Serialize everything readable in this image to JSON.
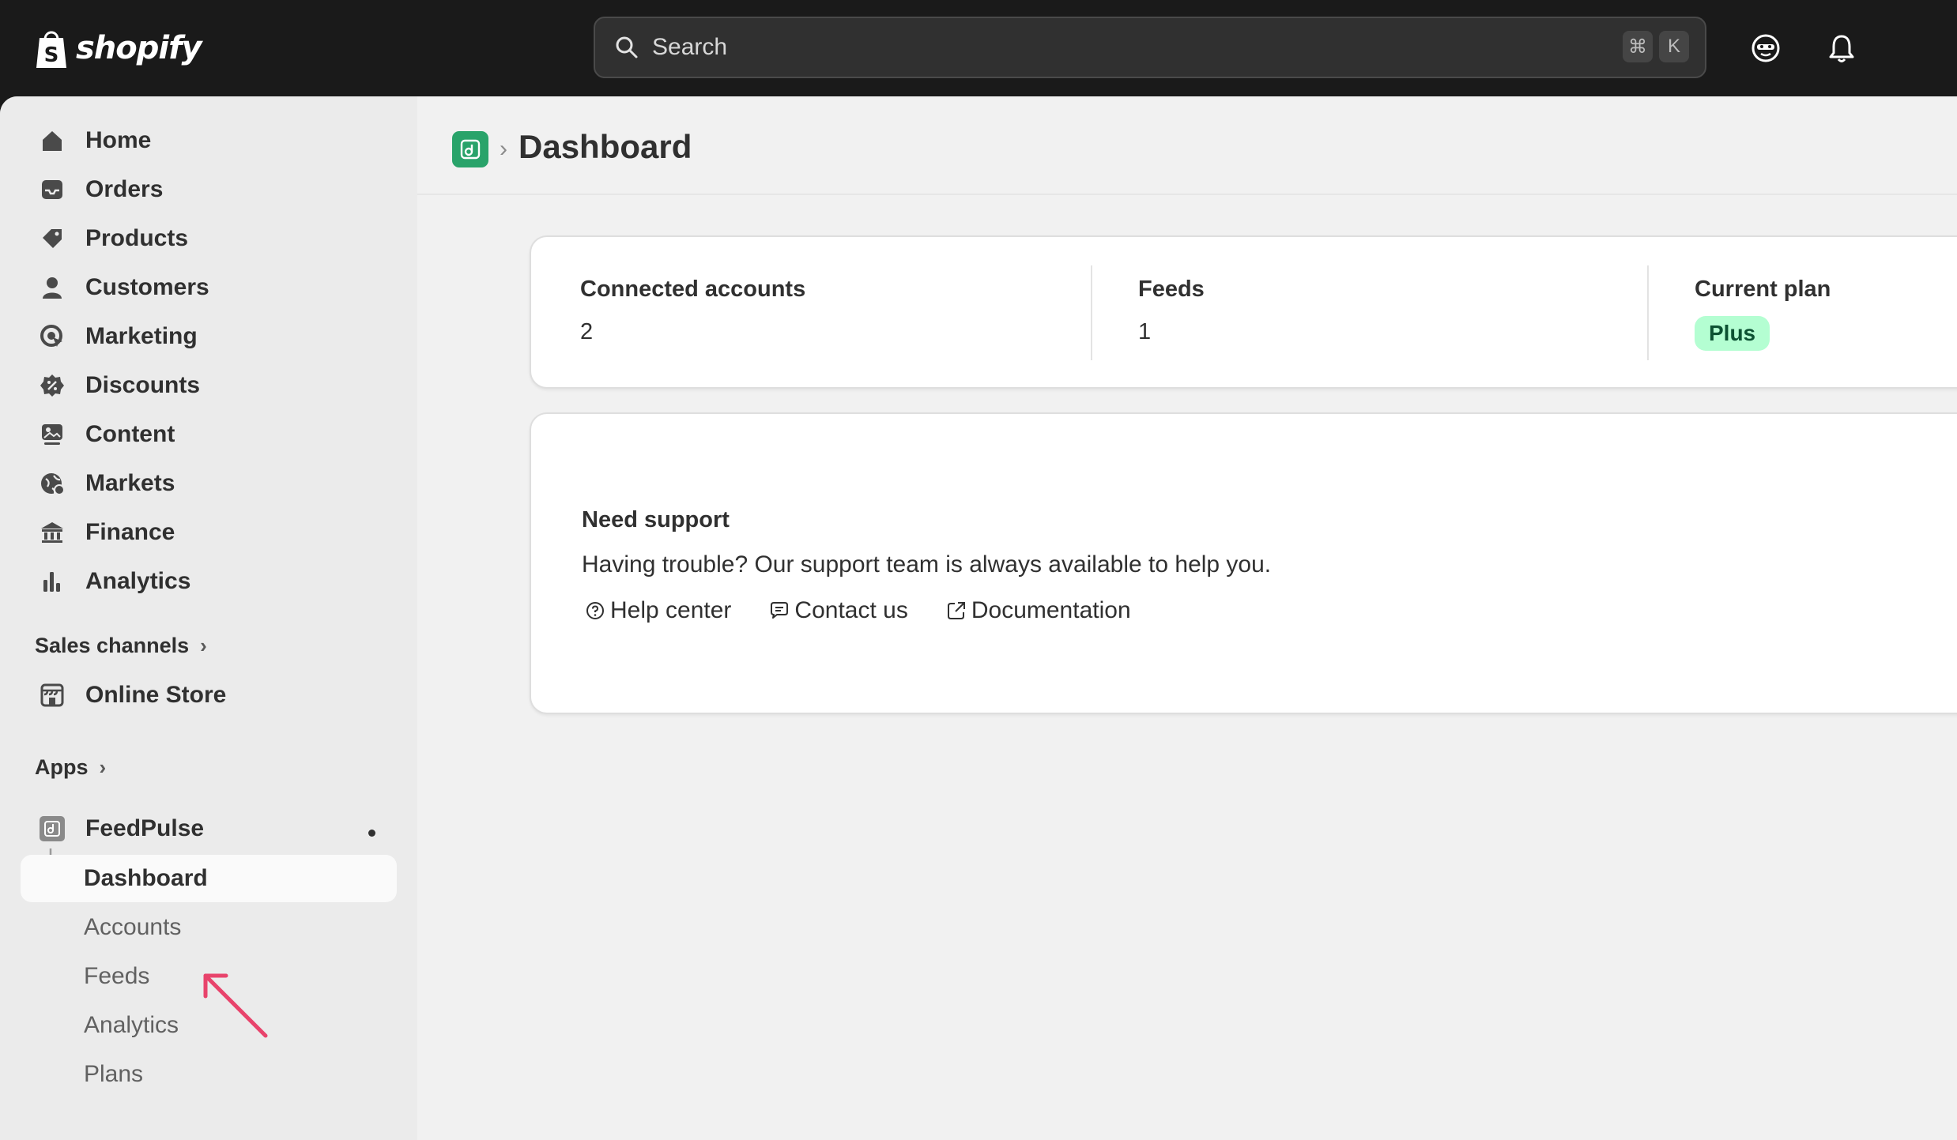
{
  "topbar": {
    "logo_text": "shopify",
    "search": {
      "placeholder": "Search",
      "shortcut_keys": [
        "⌘",
        "K"
      ]
    },
    "icons": [
      "search-icon",
      "user-avatar-icon",
      "bell-icon"
    ]
  },
  "sidebar": {
    "items": [
      {
        "label": "Home",
        "icon": "home-icon"
      },
      {
        "label": "Orders",
        "icon": "inbox-icon"
      },
      {
        "label": "Products",
        "icon": "tag-icon"
      },
      {
        "label": "Customers",
        "icon": "person-icon"
      },
      {
        "label": "Marketing",
        "icon": "target-icon"
      },
      {
        "label": "Discounts",
        "icon": "discount-icon"
      },
      {
        "label": "Content",
        "icon": "image-icon"
      },
      {
        "label": "Markets",
        "icon": "globe-icon"
      },
      {
        "label": "Finance",
        "icon": "bank-icon"
      },
      {
        "label": "Analytics",
        "icon": "bar-chart-icon"
      }
    ],
    "sales_channels": {
      "label": "Sales channels",
      "items": [
        {
          "label": "Online Store",
          "icon": "store-icon"
        }
      ]
    },
    "apps": {
      "label": "Apps",
      "app": {
        "label": "FeedPulse",
        "icon": "feedpulse-icon",
        "subitems": [
          {
            "label": "Dashboard",
            "active": true
          },
          {
            "label": "Accounts",
            "active": false
          },
          {
            "label": "Feeds",
            "active": false
          },
          {
            "label": "Analytics",
            "active": false
          },
          {
            "label": "Plans",
            "active": false
          }
        ]
      }
    }
  },
  "main": {
    "breadcrumb_separator": "›",
    "title": "Dashboard",
    "stats": [
      {
        "label": "Connected accounts",
        "value": "2"
      },
      {
        "label": "Feeds",
        "value": "1"
      },
      {
        "label": "Current plan",
        "value": "Plus"
      }
    ],
    "support": {
      "title": "Need support",
      "description": "Having trouble? Our support team is always available to help you.",
      "links": [
        {
          "label": "Help center",
          "icon": "help-circle-icon"
        },
        {
          "label": "Contact us",
          "icon": "chat-icon"
        },
        {
          "label": "Documentation",
          "icon": "external-link-icon"
        }
      ]
    }
  },
  "colors": {
    "topbar_bg": "#1a1a1a",
    "sidebar_bg": "#ebebeb",
    "main_bg": "#f1f1f1",
    "app_accent": "#29a36a",
    "plan_badge_bg": "#b4fed2",
    "annotation_arrow": "#e8436b"
  }
}
